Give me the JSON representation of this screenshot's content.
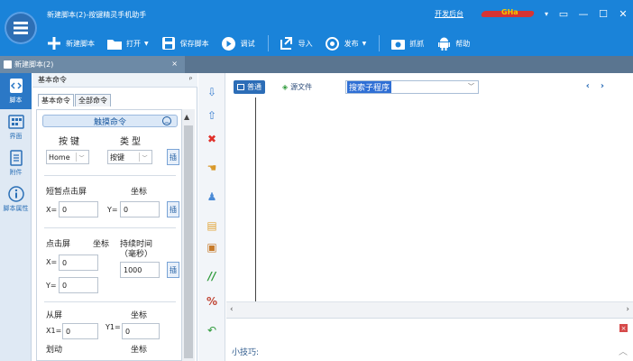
{
  "window": {
    "title": "新建脚本(2)-按键精灵手机助手",
    "link": "开发后台",
    "user_name": "GHa",
    "controls": [
      "▾",
      "▭",
      "—",
      "☐",
      "✕"
    ]
  },
  "toolbar": {
    "items": [
      {
        "label": "新建脚本",
        "icon": "plus-icon"
      },
      {
        "label": "打开",
        "icon": "folder-icon",
        "dropdown": true
      },
      {
        "label": "保存脚本",
        "icon": "save-icon"
      },
      {
        "label": "调试",
        "icon": "play-icon"
      },
      {
        "label": "导入",
        "icon": "import-icon"
      },
      {
        "label": "发布",
        "icon": "publish-icon",
        "dropdown": true
      },
      {
        "label": "抓抓",
        "icon": "camera-icon"
      },
      {
        "label": "帮助",
        "icon": "android-icon"
      }
    ]
  },
  "doc_tab": {
    "label": "新建脚本(2)",
    "close": "×"
  },
  "leftnav": {
    "items": [
      {
        "label": "脚本",
        "active": true
      },
      {
        "label": "界面"
      },
      {
        "label": "附件"
      },
      {
        "label": "脚本属性"
      }
    ]
  },
  "cmdpanel": {
    "header": "基本命令",
    "pin": "ᴾ",
    "tabs": [
      "基本命令",
      "全部命令"
    ],
    "section": "触摸命令",
    "key": {
      "label1": "按键",
      "label2": "类型",
      "key_value": "Home",
      "type_value": "按键"
    },
    "tap": {
      "label": "短暂点击屏",
      "coord": "坐标",
      "x_label": "X=",
      "x": "0",
      "y_label": "Y=",
      "y": "0"
    },
    "press": {
      "label": "点击屏",
      "coord": "坐标",
      "duration": "持续时间",
      "unit": "（毫秒）",
      "x_label": "X=",
      "x": "0",
      "y_label": "Y=",
      "y": "0",
      "ms": "1000"
    },
    "from": {
      "label": "从屏",
      "coord": "坐标",
      "x1_label": "X1=",
      "x1": "0",
      "y1_label": "Y1=",
      "y1": "0"
    },
    "swipe": {
      "label": "划动",
      "coord": "坐标"
    },
    "insert": "插"
  },
  "editor": {
    "view_normal": "普通",
    "view_source": "源文件",
    "sub_search": "搜索子程序",
    "prev": "‹",
    "next": "›"
  },
  "tips": {
    "title": "小技巧:"
  }
}
